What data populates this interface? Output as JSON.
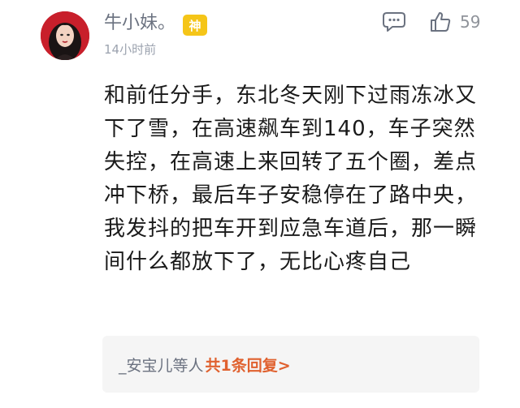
{
  "post": {
    "username": "牛小妹。",
    "badge": "神",
    "timestamp": "14小时前",
    "like_count": "59",
    "body": "和前任分手，东北冬天刚下过雨冻冰又下了雪，在高速飙车到140，车子突然失控，在高速上来回转了五个圈，差点冲下桥，最后车子安稳停在了路中央，我发抖的把车开到应急车道后，那一瞬间什么都放下了，无比心疼自己"
  },
  "replies": {
    "users": "_安宝儿等人",
    "summary": "共1条回复>"
  },
  "icons": [
    "avatar",
    "comment-icon",
    "like-icon"
  ],
  "colors": {
    "badge": "#f5c518",
    "reply_link": "#e0612f",
    "avatar_bg": "#c81f2b"
  }
}
